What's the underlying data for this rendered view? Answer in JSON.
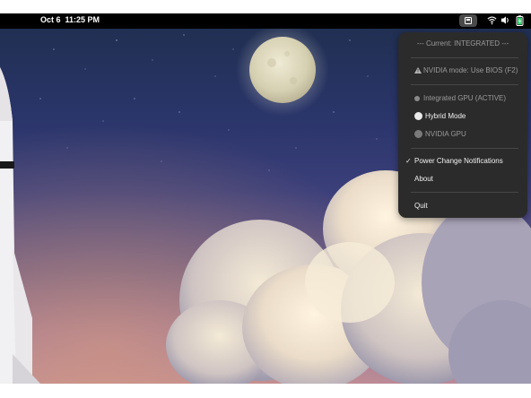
{
  "topbar": {
    "date": "Oct 6",
    "time": "11:25 PM"
  },
  "tray": {
    "icons": [
      "gpu-indicator-icon",
      "wifi-icon",
      "volume-icon",
      "battery-charging-icon"
    ]
  },
  "menu": {
    "current_status": "--- Current: INTEGRATED ---",
    "warning": "NVIDIA mode: Use BIOS (F2)",
    "modes": [
      {
        "label": "Integrated GPU (ACTIVE)",
        "enabled": false
      },
      {
        "label": "Hybrid Mode",
        "enabled": true
      },
      {
        "label": "NVIDIA GPU",
        "enabled": false
      }
    ],
    "notifications": {
      "label": "Power Change Notifications",
      "checked": true
    },
    "about": "About",
    "quit": "Quit"
  },
  "colors": {
    "menu_bg": "#2b2b2b",
    "topbar_bg": "#000000"
  }
}
